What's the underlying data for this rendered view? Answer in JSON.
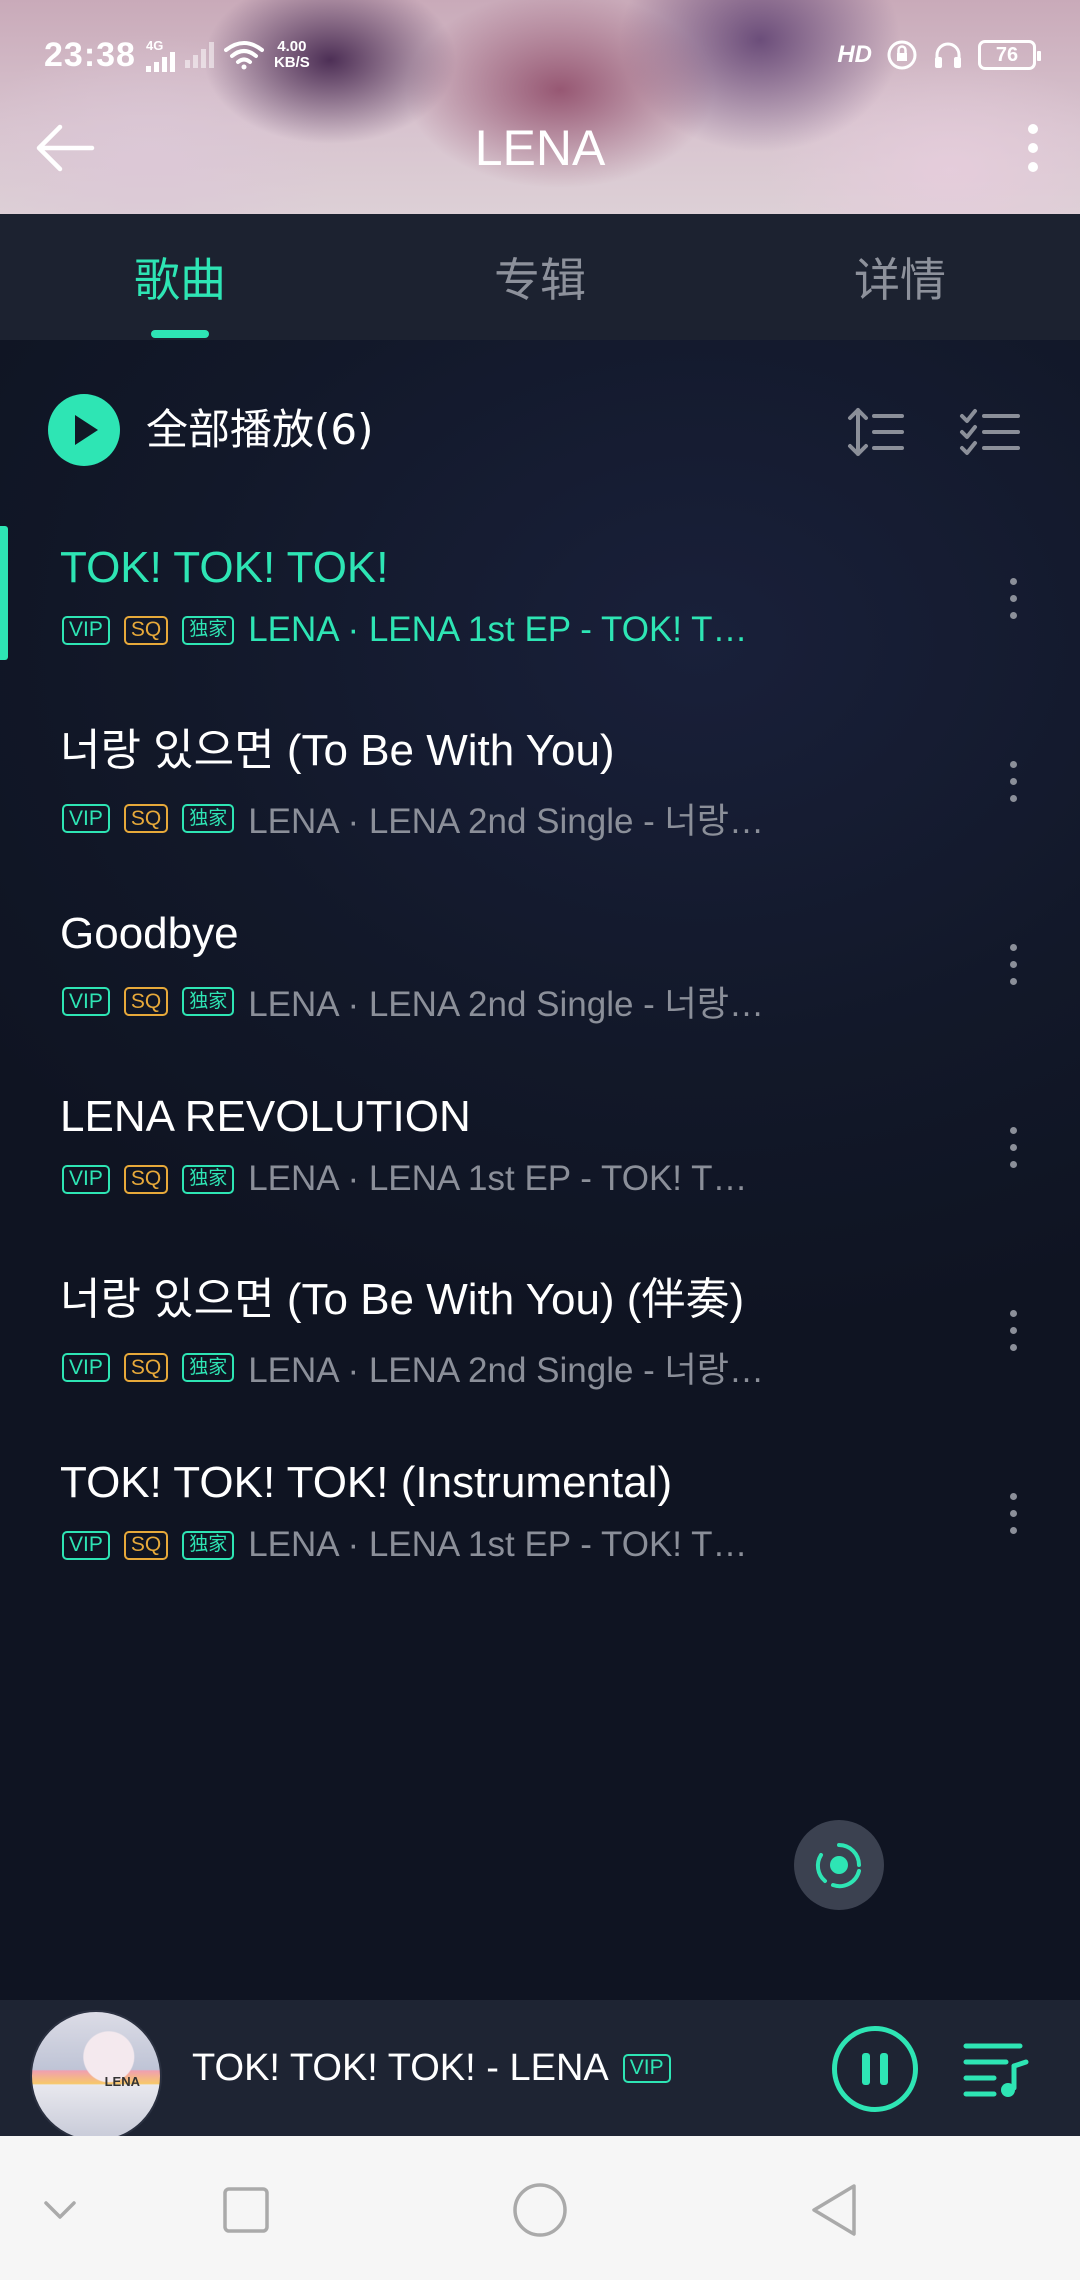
{
  "status_bar": {
    "time": "23:38",
    "network_type": "4G",
    "speed_value": "4.00",
    "speed_unit": "KB/S",
    "hd_label": "HD",
    "battery": "76"
  },
  "header": {
    "title": "LENA"
  },
  "tabs": [
    {
      "label": "歌曲",
      "active": true
    },
    {
      "label": "专辑",
      "active": false
    },
    {
      "label": "详情",
      "active": false
    }
  ],
  "play_all": {
    "label": "全部播放(6)"
  },
  "badges": {
    "vip": "VIP",
    "sq": "SQ",
    "exclusive": "独家"
  },
  "songs": [
    {
      "title": "TOK! TOK! TOK!",
      "subtitle": "LENA · LENA 1st EP - TOK! T…",
      "active": true
    },
    {
      "title": "너랑 있으면 (To Be With You)",
      "subtitle": "LENA · LENA 2nd Single - 너랑…",
      "active": false
    },
    {
      "title": "Goodbye",
      "subtitle": "LENA · LENA 2nd Single - 너랑…",
      "active": false
    },
    {
      "title": "LENA REVOLUTION",
      "subtitle": "LENA · LENA 1st EP - TOK! T…",
      "active": false
    },
    {
      "title": "너랑 있으면 (To Be With You) (伴奏)",
      "subtitle": "LENA · LENA 2nd Single - 너랑…",
      "active": false
    },
    {
      "title": "TOK! TOK! TOK! (Instrumental)",
      "subtitle": "LENA · LENA 1st EP - TOK! T…",
      "active": false
    }
  ],
  "player": {
    "now_playing": "TOK! TOK! TOK! - LENA",
    "badge": "VIP",
    "cover_text": "LENA"
  },
  "colors": {
    "accent": "#2ee5b4",
    "sq": "#e7a93a",
    "background": "#111726",
    "muted_text": "#8b8f99"
  },
  "icons": {
    "back": "arrow-left-icon",
    "more": "more-vertical-icon",
    "play_all": "play-icon",
    "sort": "sort-icon",
    "multi_select": "checklist-icon",
    "locate": "locate-icon",
    "pause": "pause-icon",
    "queue": "playlist-icon",
    "nav": [
      "chevron-down-icon",
      "square-icon",
      "circle-icon",
      "triangle-back-icon"
    ]
  }
}
